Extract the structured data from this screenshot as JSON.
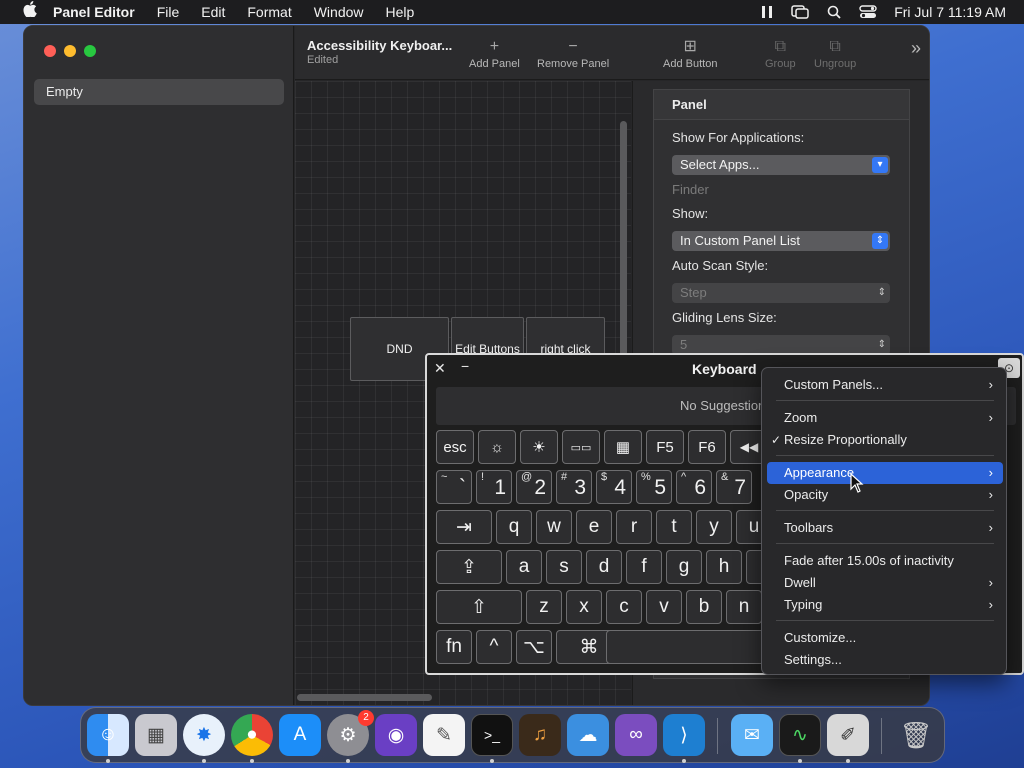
{
  "menubar": {
    "app_name": "Panel Editor",
    "menus": [
      "File",
      "Edit",
      "Format",
      "Window",
      "Help"
    ],
    "clock": "Fri Jul 7  11:19 AM"
  },
  "window": {
    "sidebar": {
      "selected_item": "Empty"
    },
    "toolbar": {
      "title": "Accessibility Keyboar...",
      "subtitle": "Edited",
      "add_panel": "Add Panel",
      "remove_panel": "Remove Panel",
      "add_button": "Add Button",
      "group": "Group",
      "ungroup": "Ungroup"
    },
    "canvas": {
      "buttons": [
        "DND",
        "Edit Buttons",
        "right click"
      ]
    },
    "inspector": {
      "header": "Panel",
      "show_for_apps_label": "Show For Applications:",
      "select_apps": "Select Apps...",
      "finder": "Finder",
      "show_label": "Show:",
      "show_value": "In Custom Panel List",
      "auto_scan_label": "Auto Scan Style:",
      "auto_scan_value": "Step",
      "gliding_label": "Gliding Lens Size:",
      "gliding_value": "5"
    }
  },
  "keyboard": {
    "title": "Keyboard",
    "suggestion": "No Suggestion",
    "fn_row": [
      "esc",
      "☼",
      "☀",
      "▭▭",
      "▦",
      "F5",
      "F6",
      "◀◀"
    ],
    "number_row": [
      {
        "shift": "~",
        "main": "`"
      },
      {
        "shift": "!",
        "main": "1"
      },
      {
        "shift": "@",
        "main": "2"
      },
      {
        "shift": "#",
        "main": "3"
      },
      {
        "shift": "$",
        "main": "4"
      },
      {
        "shift": "%",
        "main": "5"
      },
      {
        "shift": "^",
        "main": "6"
      },
      {
        "shift": "&",
        "main": "7"
      }
    ],
    "tab": "⇥",
    "top_row": [
      "q",
      "w",
      "e",
      "r",
      "t",
      "y",
      "u"
    ],
    "caps": "⇪",
    "home_row": [
      "a",
      "s",
      "d",
      "f",
      "g",
      "h"
    ],
    "shift": "⇧",
    "bottom_row": [
      "z",
      "x",
      "c",
      "v",
      "b",
      "n"
    ],
    "fn": "fn",
    "control": "^",
    "option": "⌥",
    "command": "⌘"
  },
  "context_menu": {
    "items": [
      {
        "label": "Custom Panels...",
        "submenu": true
      },
      {
        "label": "Zoom",
        "submenu": true
      },
      {
        "label": "Resize Proportionally",
        "checked": true
      },
      {
        "label": "Appearance",
        "submenu": true,
        "highlighted": true
      },
      {
        "label": "Opacity",
        "submenu": true
      },
      {
        "label": "Toolbars",
        "submenu": true
      },
      {
        "label": "Fade after 15.00s of inactivity"
      },
      {
        "label": "Dwell",
        "submenu": true
      },
      {
        "label": "Typing",
        "submenu": true
      },
      {
        "label": "Customize..."
      },
      {
        "label": "Settings..."
      }
    ]
  },
  "dock": {
    "apps": [
      "Finder",
      "Launchpad",
      "Safari",
      "Chrome",
      "App Store",
      "System Settings",
      "Notchmeister",
      "TextEdit",
      "Terminal",
      "GarageBand",
      "Weather",
      "Visual Studio",
      "VS Code",
      "Mail",
      "Activity Monitor",
      "Script Editor",
      "Trash"
    ],
    "settings_badge": "2"
  },
  "colors": {
    "accent": "#2c63d8",
    "close": "#ff5f57",
    "minimize": "#febc2e",
    "zoom": "#28c840"
  }
}
